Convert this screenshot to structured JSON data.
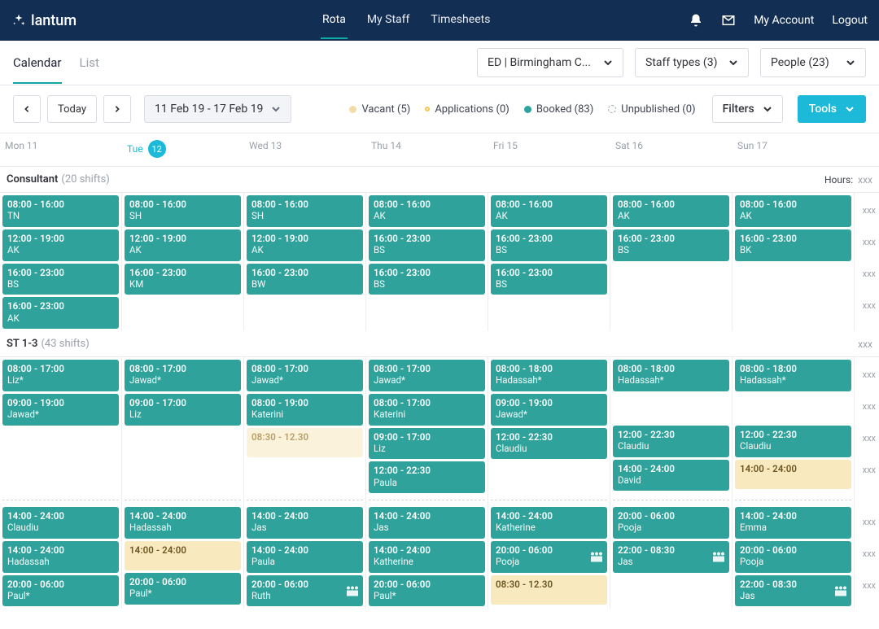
{
  "topnav": {
    "brand": "lantum",
    "links": [
      "Rota",
      "My Staff",
      "Timesheets"
    ],
    "active": 0,
    "account": "My Account",
    "logout": "Logout"
  },
  "subnav": {
    "tabs": [
      "Calendar",
      "List"
    ],
    "active": 0,
    "dept": "ED | Birmingham C...",
    "staff_types": "Staff types (3)",
    "people": "People (23)"
  },
  "toolbar": {
    "today": "Today",
    "range": "11 Feb 19 - 17 Feb 19",
    "legend": {
      "vacant": "Vacant (5)",
      "applications": "Applications (0)",
      "booked": "Booked (83)",
      "unpublished": "Unpublished (0)"
    },
    "filters": "Filters",
    "tools": "Tools"
  },
  "days": [
    {
      "label": "Mon",
      "num": "11",
      "today": false
    },
    {
      "label": "Tue",
      "num": "12",
      "today": true
    },
    {
      "label": "Wed",
      "num": "13",
      "today": false
    },
    {
      "label": "Thu",
      "num": "14",
      "today": false
    },
    {
      "label": "Fri",
      "num": "15",
      "today": false
    },
    {
      "label": "Sat",
      "num": "16",
      "today": false
    },
    {
      "label": "Sun",
      "num": "17",
      "today": false
    }
  ],
  "groups": [
    {
      "name": "Consultant",
      "count": "(20 shifts)",
      "hours_label": "Hours:",
      "hours_val": "xxx",
      "rows": 4,
      "columns": [
        [
          {
            "t": "08:00 - 16:00",
            "n": "TN",
            "v": "booked"
          },
          {
            "t": "12:00 - 19:00",
            "n": "AK",
            "v": "booked"
          },
          {
            "t": "16:00 - 23:00",
            "n": "BS",
            "v": "booked"
          },
          {
            "t": "16:00 - 23:00",
            "n": "AK",
            "v": "booked"
          }
        ],
        [
          {
            "t": "08:00 - 16:00",
            "n": "SH",
            "v": "booked"
          },
          {
            "t": "12:00 - 19:00",
            "n": "AK",
            "v": "booked"
          },
          {
            "t": "16:00 - 23:00",
            "n": "KM",
            "v": "booked"
          }
        ],
        [
          {
            "t": "08:00 - 16:00",
            "n": "SH",
            "v": "booked"
          },
          {
            "t": "12:00 - 19:00",
            "n": "AK",
            "v": "booked"
          },
          {
            "t": "16:00 - 23:00",
            "n": "BW",
            "v": "booked"
          }
        ],
        [
          {
            "t": "08:00 - 16:00",
            "n": "AK",
            "v": "booked"
          },
          {
            "t": "16:00 - 23:00",
            "n": "BS",
            "v": "booked"
          },
          {
            "t": "16:00 - 23:00",
            "n": "BS",
            "v": "booked"
          }
        ],
        [
          {
            "t": "08:00 - 16:00",
            "n": "AK",
            "v": "booked"
          },
          {
            "t": "16:00 - 23:00",
            "n": "BS",
            "v": "booked"
          },
          {
            "t": "16:00 - 23:00",
            "n": "BS",
            "v": "booked"
          }
        ],
        [
          {
            "t": "08:00 - 16:00",
            "n": "AK",
            "v": "booked"
          },
          {
            "t": "16:00 - 23:00",
            "n": "BS",
            "v": "booked"
          }
        ],
        [
          {
            "t": "08:00 - 16:00",
            "n": "AK",
            "v": "booked"
          },
          {
            "t": "16:00 - 23:00",
            "n": "BK",
            "v": "booked"
          }
        ]
      ]
    },
    {
      "name": "ST 1-3",
      "count": "(43 shifts)",
      "hours_label": "",
      "hours_val": "xxx",
      "dashed_after_upper": true,
      "columns_upper": [
        [
          {
            "t": "08:00 - 17:00",
            "n": "Liz*",
            "v": "booked"
          },
          {
            "t": "09:00 - 19:00",
            "n": "Jawad*",
            "v": "booked"
          }
        ],
        [
          {
            "t": "08:00 - 17:00",
            "n": "Jawad*",
            "v": "booked"
          },
          {
            "t": "09:00 - 17:00",
            "n": "Liz",
            "v": "booked"
          }
        ],
        [
          {
            "t": "08:00 - 17:00",
            "n": "Jawad*",
            "v": "booked"
          },
          {
            "t": "08:00 - 19:00",
            "n": "Katerini",
            "v": "booked"
          },
          {
            "t": "08:30 - 12.30",
            "n": "",
            "v": "vacant-light"
          }
        ],
        [
          {
            "t": "08:00 - 17:00",
            "n": "Jawad*",
            "v": "booked"
          },
          {
            "t": "08:00 - 17:00",
            "n": "Katerini",
            "v": "booked"
          },
          {
            "t": "09:00 - 17:00",
            "n": "Liz",
            "v": "booked"
          },
          {
            "t": "12:00 - 22:30",
            "n": "Paula",
            "v": "booked"
          }
        ],
        [
          {
            "t": "08:00 - 18:00",
            "n": "Hadassah*",
            "v": "booked"
          },
          {
            "t": "09:00 - 19:00",
            "n": "Jawad*",
            "v": "booked"
          },
          {
            "t": "12:00 - 22:30",
            "n": "Claudiu",
            "v": "booked"
          }
        ],
        [
          {
            "t": "08:00 - 18:00",
            "n": "Hadassah*",
            "v": "booked"
          },
          {
            "t": "",
            "n": "",
            "v": "spacer"
          },
          {
            "t": "12:00 - 22:30",
            "n": "Claudiu",
            "v": "booked"
          },
          {
            "t": "14:00 - 24:00",
            "n": "David",
            "v": "booked"
          }
        ],
        [
          {
            "t": "08:00 - 18:00",
            "n": "Hadassah*",
            "v": "booked"
          },
          {
            "t": "",
            "n": "",
            "v": "spacer"
          },
          {
            "t": "12:00 - 22:30",
            "n": "Claudiu",
            "v": "booked"
          },
          {
            "t": "14:00 - 24:00",
            "n": "",
            "v": "vacant"
          }
        ]
      ],
      "columns_lower": [
        [
          {
            "t": "14:00 - 24:00",
            "n": "Claudiu",
            "v": "booked"
          },
          {
            "t": "14:00 - 24:00",
            "n": "Hadassah",
            "v": "booked"
          },
          {
            "t": "20:00 - 06:00",
            "n": "Paul*",
            "v": "booked"
          }
        ],
        [
          {
            "t": "14:00 - 24:00",
            "n": "Hadassah",
            "v": "booked"
          },
          {
            "t": "14:00 - 24:00",
            "n": "",
            "v": "vacant"
          },
          {
            "t": "20:00 - 06:00",
            "n": "Paul*",
            "v": "booked"
          }
        ],
        [
          {
            "t": "14:00 - 24:00",
            "n": "Jas",
            "v": "booked"
          },
          {
            "t": "14:00 - 24:00",
            "n": "Paula",
            "v": "booked"
          },
          {
            "t": "20:00 - 06:00",
            "n": "Ruth",
            "v": "booked",
            "store": true
          }
        ],
        [
          {
            "t": "14:00 - 24:00",
            "n": "Jas",
            "v": "booked"
          },
          {
            "t": "14:00 - 24:00",
            "n": "Katherine",
            "v": "booked"
          },
          {
            "t": "20:00 - 06:00",
            "n": "Paul*",
            "v": "booked"
          }
        ],
        [
          {
            "t": "14:00 - 24:00",
            "n": "Katherine",
            "v": "booked"
          },
          {
            "t": "20:00 - 06:00",
            "n": "Pooja",
            "v": "booked",
            "store": true
          },
          {
            "t": "08:30 - 12.30",
            "n": "",
            "v": "vacant"
          }
        ],
        [
          {
            "t": "20:00 - 06:00",
            "n": "Pooja",
            "v": "booked"
          },
          {
            "t": "22:00 - 08:30",
            "n": "Jas",
            "v": "booked",
            "store": true
          }
        ],
        [
          {
            "t": "14:00 - 24:00",
            "n": "Emma",
            "v": "booked"
          },
          {
            "t": "20:00 - 06:00",
            "n": "Pooja",
            "v": "booked"
          },
          {
            "t": "22:00 - 08:30",
            "n": "Jas",
            "v": "booked",
            "store": true
          }
        ]
      ],
      "row_hours_upper": [
        "xxx",
        "xxx",
        "xxx",
        "xxx"
      ],
      "row_hours_lower": [
        "xxx",
        "xxx",
        "xxx"
      ]
    }
  ]
}
